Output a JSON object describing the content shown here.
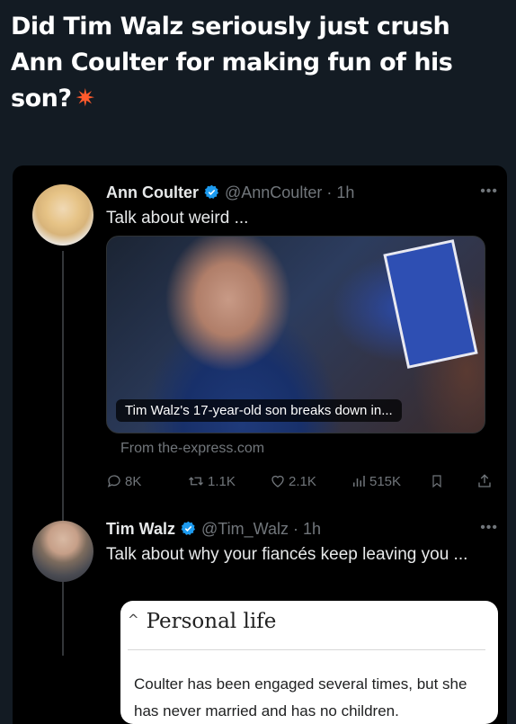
{
  "headline": "Did Tim Walz seriously just crush Ann Coulter for making fun of his son?",
  "tweet1": {
    "name": "Ann Coulter",
    "handle": "@AnnCoulter · 1h",
    "text": "Talk about weird ...",
    "media_caption": "Tim Walz's 17-year-old son breaks down in...",
    "source": "From the-express.com",
    "actions": {
      "replies": "8K",
      "retweets": "1.1K",
      "likes": "2.1K",
      "views": "515K"
    }
  },
  "tweet2": {
    "name": "Tim Walz",
    "handle": "@Tim_Walz · 1h",
    "text": "Talk about why your fiancés keep leaving you ..."
  },
  "note": {
    "title": "Personal life",
    "body": "Coulter has been engaged several times, but she has never married and has no children."
  },
  "colors": {
    "background": "#131b23",
    "card": "#000000",
    "verified": "#1d9bf0",
    "muted": "#71767b"
  },
  "icons": [
    "sparkle-emoji",
    "verified-badge-icon",
    "more-icon",
    "reply-icon",
    "retweet-icon",
    "like-icon",
    "views-icon",
    "bookmark-icon",
    "share-icon",
    "chevron-up-icon"
  ]
}
